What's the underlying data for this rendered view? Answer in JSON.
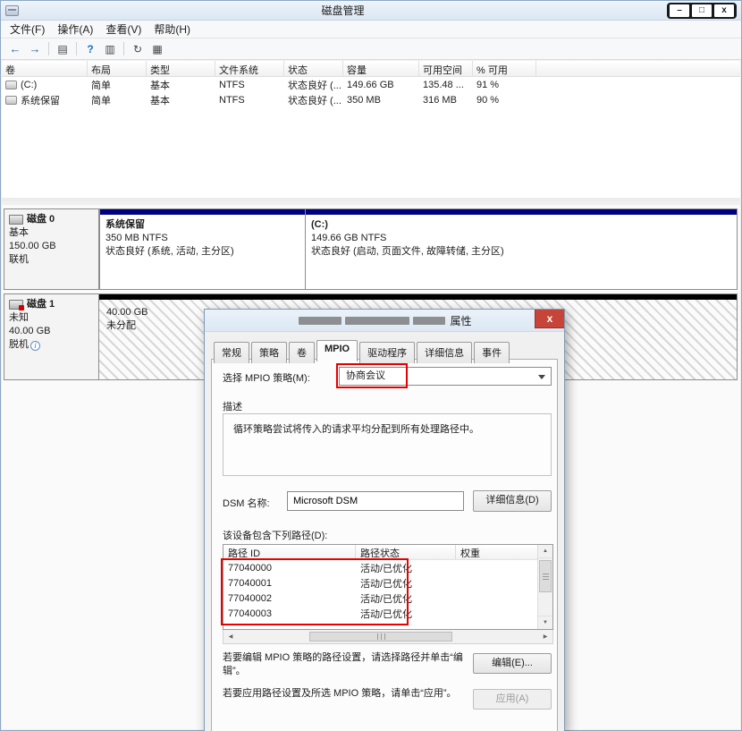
{
  "window": {
    "title": "磁盘管理",
    "controls": {
      "minimize": "–",
      "maximize": "□",
      "close": "x"
    }
  },
  "menu": {
    "items": [
      "文件(F)",
      "操作(A)",
      "查看(V)",
      "帮助(H)"
    ]
  },
  "toolbar": {
    "icons": {
      "back": "←",
      "forward": "→",
      "list": "▤",
      "help": "?",
      "view": "▥",
      "refresh": "↻",
      "console": "▦"
    }
  },
  "volume_table": {
    "columns": [
      "卷",
      "布局",
      "类型",
      "文件系统",
      "状态",
      "容量",
      "可用空间",
      "% 可用"
    ],
    "rows": [
      {
        "volume": "(C:)",
        "layout": "简单",
        "type": "基本",
        "fs": "NTFS",
        "status": "状态良好 (...",
        "capacity": "149.66 GB",
        "free": "135.48 ...",
        "pct": "91 %"
      },
      {
        "volume": "系统保留",
        "layout": "简单",
        "type": "基本",
        "fs": "NTFS",
        "status": "状态良好 (...",
        "capacity": "350 MB",
        "free": "316 MB",
        "pct": "90 %"
      }
    ]
  },
  "disk0": {
    "label": "磁盘 0",
    "type": "基本",
    "size": "150.00 GB",
    "status": "联机",
    "partitions": [
      {
        "title": "系统保留",
        "line2": "350 MB NTFS",
        "line3": "状态良好 (系统, 活动, 主分区)"
      },
      {
        "title": "(C:)",
        "line2": "149.66 GB NTFS",
        "line3": "状态良好 (启动, 页面文件, 故障转储, 主分区)"
      }
    ]
  },
  "disk1": {
    "label": "磁盘 1",
    "type": "未知",
    "size": "40.00 GB",
    "status": "脱机",
    "info_icon": "i",
    "region": {
      "size": "40.00 GB",
      "state": "未分配"
    }
  },
  "dialog": {
    "title_suffix": "属性",
    "close_label": "x",
    "tabs": [
      "常规",
      "策略",
      "卷",
      "MPIO",
      "驱动程序",
      "详细信息",
      "事件"
    ],
    "active_tab": "MPIO",
    "policy_label": "选择 MPIO 策略(M):",
    "policy_value": "协商会议",
    "description_label": "描述",
    "description_text": "循环策略尝试将传入的请求平均分配到所有处理路径中。",
    "dsm_label": "DSM 名称:",
    "dsm_value": "Microsoft DSM",
    "details_button": "详细信息(D)",
    "paths_label": "该设备包含下列路径(D):",
    "path_table": {
      "columns": [
        "路径 ID",
        "路径状态",
        "权重"
      ],
      "rows": [
        {
          "id": "77040000",
          "status": "活动/已优化",
          "weight": ""
        },
        {
          "id": "77040001",
          "status": "活动/已优化",
          "weight": ""
        },
        {
          "id": "77040002",
          "status": "活动/已优化",
          "weight": ""
        },
        {
          "id": "77040003",
          "status": "活动/已优化",
          "weight": ""
        }
      ]
    },
    "edit_hint": "若要编辑 MPIO 策略的路径设置，请选择路径并单击“编辑”。",
    "edit_button": "编辑(E)...",
    "apply_hint": "若要应用路径设置及所选 MPIO 策略，请单击“应用”。",
    "apply_button": "应用(A)"
  },
  "icons": {
    "up": "▲",
    "down": "▼",
    "left": "◀",
    "right": "▶"
  },
  "colors": {
    "annotation": "#e60000",
    "partition_stripe": "#000082",
    "unallocated_stripe": "#000000",
    "close_button": "#c64438"
  }
}
